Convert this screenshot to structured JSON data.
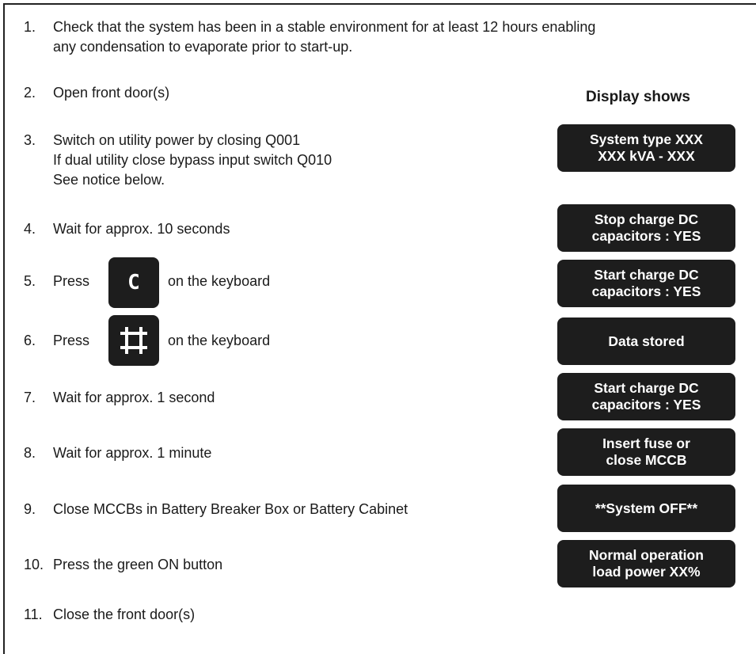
{
  "steps": [
    {
      "num": "1.",
      "lines": [
        "Check that the system has been in a stable environment for at least 12 hours enabling",
        "any condensation to evaporate prior to start-up."
      ]
    },
    {
      "num": "2.",
      "lines": [
        "Open front door(s)"
      ]
    },
    {
      "num": "3.",
      "lines": [
        "Switch on utility power by closing Q001",
        "If dual utility close bypass input switch Q010",
        "See notice below."
      ]
    },
    {
      "num": "4.",
      "lines": [
        "Wait for approx. 10 seconds"
      ]
    },
    {
      "num": "5.",
      "pre": "Press",
      "post": "on the keyboard",
      "key_icon": "c-key-icon",
      "key_label": "C"
    },
    {
      "num": "6.",
      "pre": "Press",
      "post": "on the keyboard",
      "key_icon": "enter-key-icon"
    },
    {
      "num": "7.",
      "lines": [
        "Wait for approx. 1 second"
      ]
    },
    {
      "num": "8.",
      "lines": [
        "Wait for approx. 1 minute"
      ]
    },
    {
      "num": "9.",
      "lines": [
        "Close MCCBs in Battery Breaker Box or Battery Cabinet"
      ]
    },
    {
      "num": "10.",
      "lines": [
        "Press the green ON button"
      ]
    },
    {
      "num": "11.",
      "lines": [
        "Close the front door(s)"
      ]
    }
  ],
  "display_heading": "Display shows",
  "displays": [
    {
      "lines": [
        "System type XXX",
        "XXX kVA - XXX"
      ]
    },
    {
      "lines": [
        "Stop charge DC",
        "capacitors : YES"
      ]
    },
    {
      "lines": [
        "Start charge DC",
        "capacitors : YES"
      ]
    },
    {
      "lines": [
        "Data stored"
      ]
    },
    {
      "lines": [
        "Start charge DC",
        "capacitors : YES"
      ]
    },
    {
      "lines": [
        "Insert fuse or",
        "close MCCB"
      ]
    },
    {
      "lines": [
        "**System OFF**"
      ]
    },
    {
      "lines": [
        "Normal operation",
        "load power XX%"
      ]
    }
  ],
  "colors": {
    "panel": "#1d1d1d",
    "panel_text": "#ffffff",
    "text": "#1a1a1a",
    "border": "#222222"
  }
}
